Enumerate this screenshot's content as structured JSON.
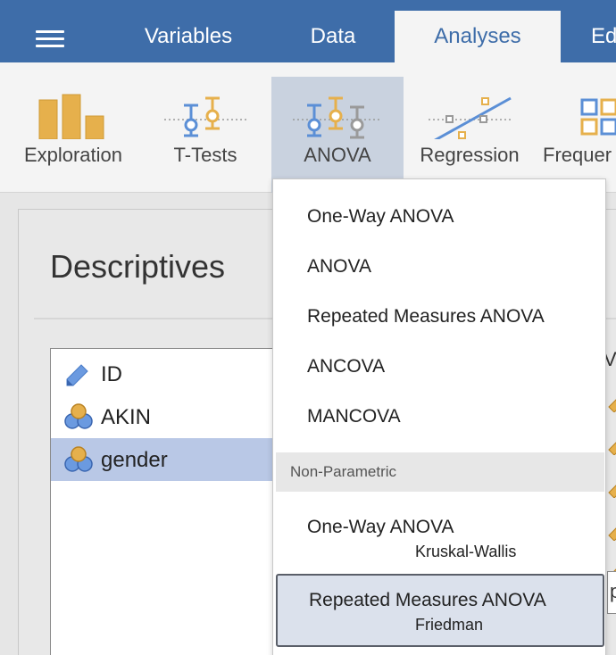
{
  "topbar": {
    "tabs": [
      {
        "label": "Variables"
      },
      {
        "label": "Data"
      },
      {
        "label": "Analyses"
      },
      {
        "label": "Ed"
      }
    ]
  },
  "ribbon": {
    "buttons": [
      {
        "label": "Exploration",
        "icon": "exploration-bar-icon"
      },
      {
        "label": "T-Tests",
        "icon": "t-tests-icon"
      },
      {
        "label": "ANOVA",
        "icon": "anova-icon"
      },
      {
        "label": "Regression",
        "icon": "regression-icon"
      },
      {
        "label": "Frequer",
        "icon": "frequencies-icon"
      }
    ]
  },
  "analysis": {
    "title": "Descriptives",
    "variables": [
      {
        "name": "ID",
        "icon": "ruler-pencil-icon"
      },
      {
        "name": "AKIN",
        "icon": "nominal-circles-icon"
      },
      {
        "name": "gender",
        "icon": "nominal-circles-icon",
        "selected": true
      }
    ],
    "right_partial_label": "Va",
    "right_partial_box": "p"
  },
  "anova_menu": {
    "items": [
      {
        "label": "One-Way ANOVA"
      },
      {
        "label": "ANOVA"
      },
      {
        "label": "Repeated Measures ANOVA"
      },
      {
        "label": "ANCOVA"
      },
      {
        "label": "MANCOVA"
      }
    ],
    "section": "Non-Parametric",
    "nonparametric": [
      {
        "label": "One-Way ANOVA",
        "sub": "Kruskal-Wallis"
      },
      {
        "label": "Repeated Measures ANOVA",
        "sub": "Friedman",
        "highlighted": true
      }
    ]
  },
  "colors": {
    "topbar": "#3e6da9",
    "active_ribbon": "#c9d2df",
    "selected_row": "#b9c8e6",
    "icon_orange": "#e6b04c",
    "icon_blue": "#5b8fd6",
    "icon_gray": "#9a9a9a"
  }
}
